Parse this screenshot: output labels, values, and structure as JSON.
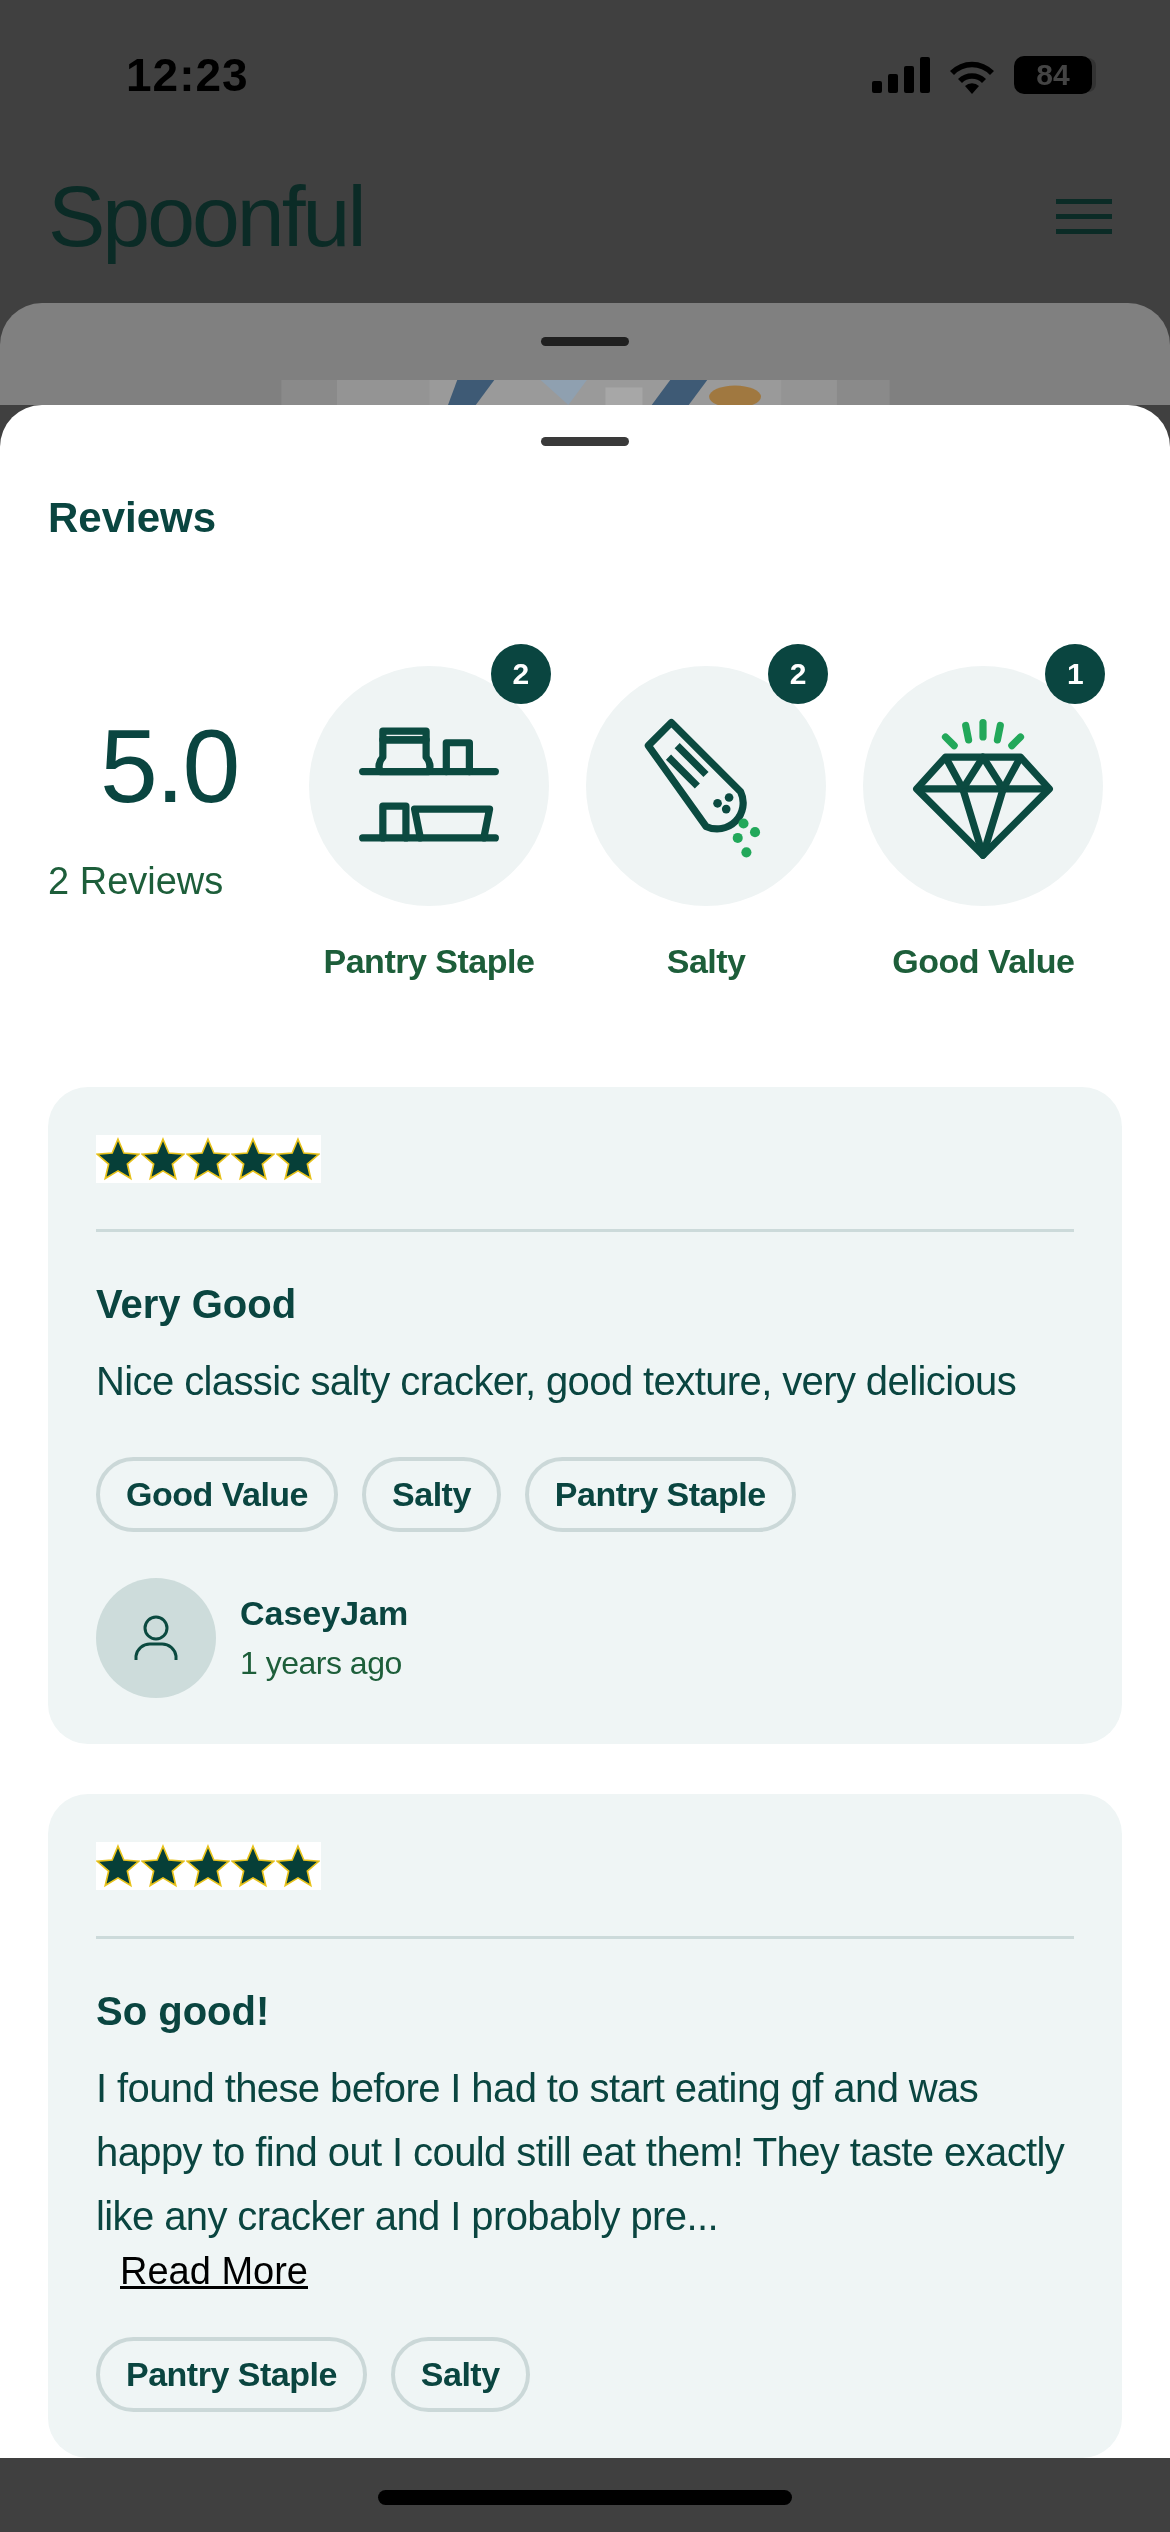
{
  "status_bar": {
    "time": "12:23",
    "battery": "84"
  },
  "header": {
    "logo": "Spoonful"
  },
  "sheet": {
    "title": "Reviews"
  },
  "summary": {
    "rating": "5.0",
    "count": "2 Reviews"
  },
  "highlights": [
    {
      "kind": "pantry",
      "label": "Pantry Staple",
      "count": "2"
    },
    {
      "kind": "salt",
      "label": "Salty",
      "count": "2"
    },
    {
      "kind": "value",
      "label": "Good Value",
      "count": "1"
    }
  ],
  "reviews": [
    {
      "stars": 5,
      "title": "Very Good",
      "body": "Nice classic salty cracker, good texture, very delicious",
      "tags": [
        "Good Value",
        "Salty",
        "Pantry Staple"
      ],
      "author": "CaseyJam",
      "time": "1 years ago"
    },
    {
      "stars": 5,
      "title": "So good!",
      "body": "I found these before I had to start eating gf and was happy to find out I could still eat them! They taste exactly like any cracker and I probably pre...",
      "read_more": "Read More",
      "tags": [
        "Pantry Staple",
        "Salty"
      ]
    }
  ]
}
